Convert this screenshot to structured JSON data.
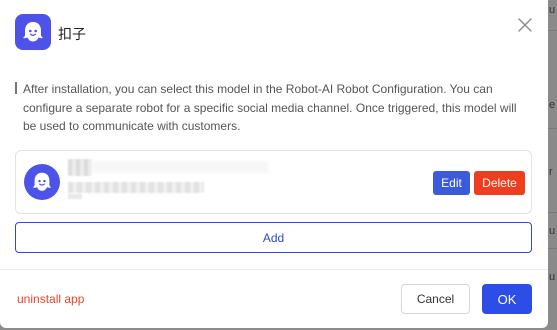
{
  "dialog": {
    "app_name": "扣子",
    "app_icon": "coze-bot-icon",
    "close_icon": "close-icon",
    "notice": "After installation, you can select this model in the Robot-AI Robot Configuration. You can configure a separate robot for a specific social media channel. Once triggered, this model will be used to communicate with customers.",
    "robot": {
      "avatar_icon": "coze-bot-icon",
      "name": "",
      "description": "",
      "edit_label": "Edit",
      "delete_label": "Delete"
    },
    "add_label": "Add",
    "uninstall_label": "uninstall app",
    "cancel_label": "Cancel",
    "ok_label": "OK"
  },
  "background": {
    "glyphs": [
      "u",
      "e",
      "r",
      "u",
      "u"
    ]
  },
  "colors": {
    "brand": "#4d53e8",
    "primary": "#2c4de6",
    "danger": "#ee3d1f"
  }
}
